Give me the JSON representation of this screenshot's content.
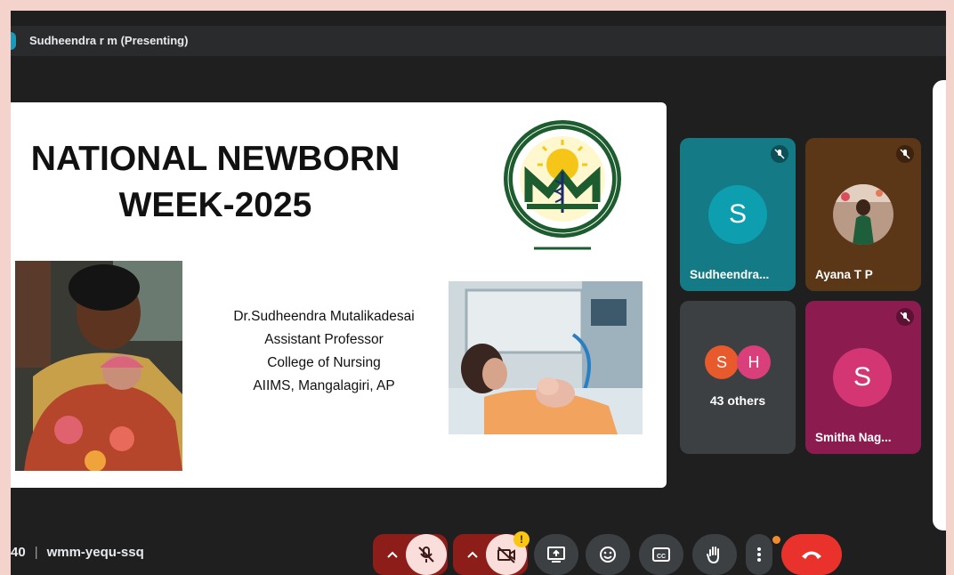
{
  "header": {
    "presenter_label": "Sudheendra r m (Presenting)"
  },
  "slide": {
    "title_line1": "NATIONAL NEWBORN",
    "title_line2": "WEEK-2025",
    "credits": [
      "Dr.Sudheendra Mutalikadesai",
      "Assistant Professor",
      "College of Nursing",
      "AIIMS, Mangalagiri, AP"
    ]
  },
  "participants": [
    {
      "initial": "S",
      "name": "Sudheendra...",
      "color": "#147a85",
      "avatar_color": "#0d9fb0",
      "muted": true
    },
    {
      "initial": "",
      "name": "Ayana T P",
      "color": "#5b3617",
      "muted": true
    },
    {
      "initial": "",
      "name": "",
      "color": "#3c4043",
      "others_label": "43 others",
      "avatars": [
        {
          "initial": "S",
          "color": "#e8592b"
        },
        {
          "initial": "H",
          "color": "#d93f7a"
        }
      ]
    },
    {
      "initial": "S",
      "name": "Smitha Nag...",
      "color": "#8c1c4f",
      "avatar_color": "#d43674",
      "muted": true
    }
  ],
  "footer": {
    "time_fragment": "40",
    "meeting_code": "wmm-yequ-ssq"
  },
  "controls": {
    "icons": [
      "mic-off-icon",
      "camera-off-icon",
      "present-icon",
      "emoji-icon",
      "captions-icon",
      "raise-hand-icon",
      "more-options-icon",
      "end-call-icon"
    ],
    "camera_warning": "!"
  },
  "colors": {
    "background": "#1f1f20",
    "frame": "#f3d3cc",
    "end_call": "#e8322b",
    "muted_control": "#8c1d18"
  }
}
